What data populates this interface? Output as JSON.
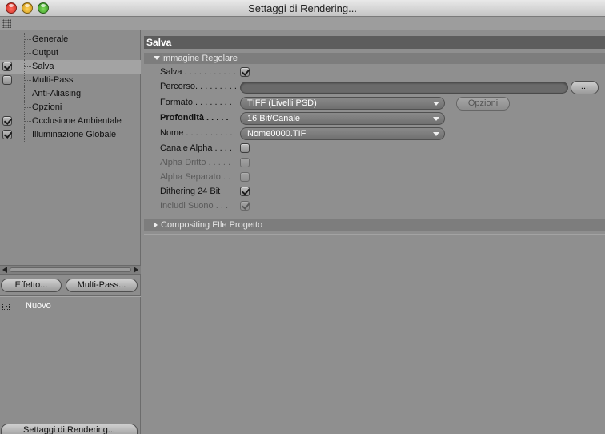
{
  "window": {
    "title": "Settaggi di Rendering..."
  },
  "sidebar": {
    "items": [
      {
        "label": "Generale",
        "checkbox": false,
        "checked": false,
        "selected": false
      },
      {
        "label": "Output",
        "checkbox": false,
        "checked": false,
        "selected": false
      },
      {
        "label": "Salva",
        "checkbox": true,
        "checked": true,
        "selected": true
      },
      {
        "label": "Multi-Pass",
        "checkbox": true,
        "checked": false,
        "selected": false
      },
      {
        "label": "Anti-Aliasing",
        "checkbox": false,
        "checked": false,
        "selected": false
      },
      {
        "label": "Opzioni",
        "checkbox": false,
        "checked": false,
        "selected": false
      },
      {
        "label": "Occlusione Ambientale",
        "checkbox": true,
        "checked": true,
        "selected": false
      },
      {
        "label": "Illuminazione Globale",
        "checkbox": true,
        "checked": true,
        "selected": false
      }
    ],
    "effetto_button": "Effetto...",
    "multipass_button": "Multi-Pass...",
    "presets": [
      {
        "label": "Nuovo"
      }
    ],
    "bottom_button": "Settaggi di Rendering..."
  },
  "main": {
    "section_title": "Salva",
    "group_immagine": "Immagine Regolare",
    "group_compositing": "Compositing FIle Progetto",
    "rows": {
      "salva": {
        "label": "Salva . . . . . . . . . . .",
        "checked": true
      },
      "percorso": {
        "label": "Percorso. . . . . . . . .",
        "value": "",
        "browse": "..."
      },
      "formato": {
        "label": "Formato . . . . . . . .",
        "value": "TIFF  (Livelli PSD)",
        "options_button": "Opzioni"
      },
      "profondita": {
        "label": "Profondità . . . . .",
        "value": "16 Bit/Canale"
      },
      "nome": {
        "label": "Nome . . . . . . . . . .",
        "value": "Nome0000.TIF"
      },
      "canale_alpha": {
        "label": "Canale Alpha . . . .",
        "checked": false
      },
      "alpha_dritto": {
        "label": "Alpha Dritto . . . . .",
        "checked": false,
        "disabled": true
      },
      "alpha_separato": {
        "label": "Alpha Separato . .",
        "checked": false,
        "disabled": true
      },
      "dithering": {
        "label": "Dithering 24 Bit",
        "checked": true
      },
      "includi_suono": {
        "label": "Includi Suono  . . .",
        "checked": true,
        "disabled": true
      }
    }
  },
  "colors": {
    "panel_bg": "#8f8f8f",
    "section_header_bg": "#5d5d5d",
    "group_header_bg": "#7d7d7d"
  }
}
